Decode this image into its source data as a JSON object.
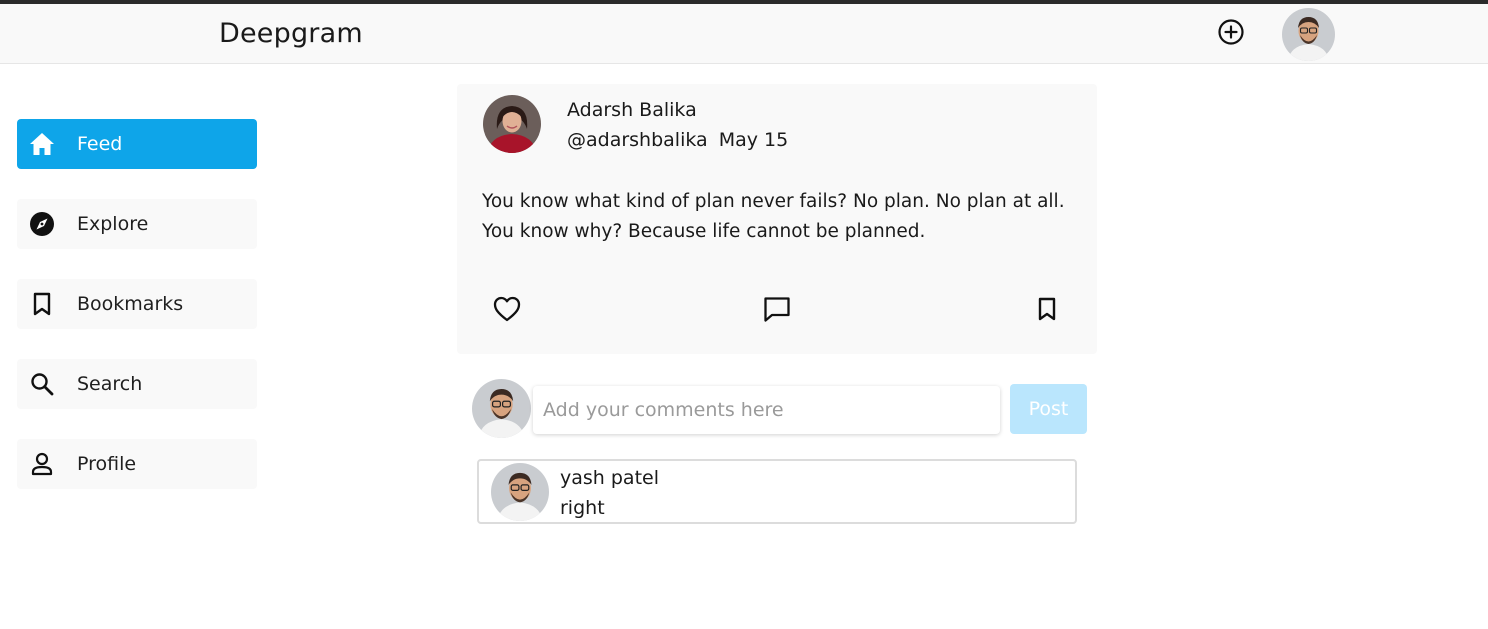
{
  "app": {
    "brand": "Deepgram"
  },
  "colors": {
    "accent": "#0ea5e9",
    "accent_light": "#bae6fd",
    "surface": "#f9f9f9"
  },
  "header": {
    "add_icon": "plus-circle-icon",
    "avatar": "user-avatar"
  },
  "sidebar": {
    "items": [
      {
        "label": "Feed",
        "icon": "home-icon",
        "active": true
      },
      {
        "label": "Explore",
        "icon": "compass-icon",
        "active": false
      },
      {
        "label": "Bookmarks",
        "icon": "bookmark-icon",
        "active": false
      },
      {
        "label": "Search",
        "icon": "search-icon",
        "active": false
      },
      {
        "label": "Profile",
        "icon": "person-icon",
        "active": false
      }
    ]
  },
  "post": {
    "author_name": "Adarsh Balika",
    "username": "@adarshbalika",
    "date": "May 15",
    "content": "You know what kind of plan never fails? No plan. No plan at all. You know why? Because life cannot be planned.",
    "actions": [
      "heart-icon",
      "comment-icon",
      "bookmark-icon"
    ]
  },
  "comment_box": {
    "placeholder": "Add your comments here",
    "submit_label": "Post"
  },
  "comments": [
    {
      "name": "yash patel",
      "text": "right"
    }
  ]
}
